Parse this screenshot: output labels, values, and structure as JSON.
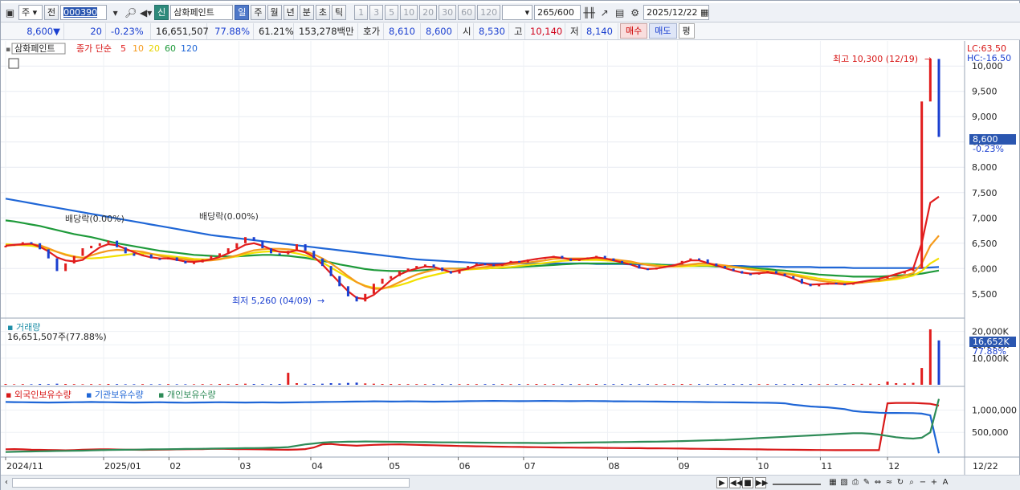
{
  "toolbar": {
    "market": "주",
    "prefix": "전",
    "code": "000390",
    "new_badge": "신",
    "stock_name": "삼화페인트",
    "periods": [
      "일",
      "주",
      "월",
      "년",
      "분",
      "초",
      "틱"
    ],
    "active_period": "일",
    "intervals": [
      "1",
      "3",
      "5",
      "10",
      "20",
      "30",
      "60",
      "120"
    ],
    "count": "265",
    "count_total": "/600",
    "date": "2025/12/22"
  },
  "quote": {
    "price": "8,600",
    "arrow": "▼",
    "change": "20",
    "change_pct": "-0.23%",
    "volume": "16,651,507",
    "vol_pct": "77.88%",
    "turnover": "61.21%",
    "amount": "153,278백만",
    "bid_label": "호가",
    "bid1": "8,610",
    "bid2": "8,600",
    "open_label": "시",
    "open": "8,530",
    "high_label": "고",
    "high": "10,140",
    "low_label": "저",
    "low": "8,140",
    "buy_label": "매수",
    "sell_label": "매도",
    "avg_label": "평"
  },
  "legend": {
    "name": "삼화페인트",
    "ma_label": "종가 단순",
    "ma_periods": [
      "5",
      "10",
      "20",
      "60",
      "120"
    ],
    "ma_colors": [
      "#e11d1d",
      "#f59a1c",
      "#f2e000",
      "#1e9a3a",
      "#1f66d6"
    ],
    "lc_label": "LC:63.50",
    "hc_label": "HC:-16.50"
  },
  "annotations": {
    "high": "최고 10,300 (12/19)",
    "low": "최저 5,260 (04/09)",
    "div1": "배당락(0.00%)",
    "div2": "배당락(0.00%)"
  },
  "axes": {
    "price_ticks": [
      "10,000",
      "9,500",
      "9,000",
      "8,500",
      "8,000",
      "7,500",
      "7,000",
      "6,500",
      "6,000",
      "5,500"
    ],
    "current_price": "8,600",
    "current_pct": "-0.23%",
    "volume_ticks": [
      "20,000K",
      "15,000K",
      "10,000K"
    ],
    "current_volume": "16,652K",
    "volume_pct": "77.88%",
    "holding_ticks": [
      "1,000,000",
      "500,000"
    ],
    "months": [
      "2024/11",
      "2025/01",
      "02",
      "03",
      "04",
      "05",
      "06",
      "07",
      "08",
      "09",
      "10",
      "11",
      "12"
    ],
    "last_date": "12/22"
  },
  "volume_panel": {
    "title": "거래량",
    "info": "16,651,507주(77.88%)"
  },
  "holding_panel": {
    "series": [
      "외국인보유수량",
      "기관보유수량",
      "개인보유수량"
    ],
    "colors": [
      "#d81818",
      "#1f66d6",
      "#2e8b57"
    ]
  },
  "chart_data": {
    "type": "line",
    "price_range": [
      5100,
      10400
    ],
    "close_series": [
      6450,
      6480,
      6520,
      6500,
      6380,
      6200,
      5950,
      6100,
      6250,
      6400,
      6450,
      6500,
      6550,
      6420,
      6300,
      6250,
      6280,
      6200,
      6180,
      6220,
      6150,
      6100,
      6120,
      6180,
      6250,
      6300,
      6400,
      6500,
      6620,
      6550,
      6400,
      6300,
      6280,
      6350,
      6480,
      6350,
      6200,
      6050,
      5850,
      5650,
      5450,
      5350,
      5500,
      5700,
      5800,
      5850,
      5950,
      6000,
      6050,
      6080,
      6020,
      5950,
      5900,
      5980,
      6050,
      6100,
      6080,
      6050,
      6100,
      6150,
      6120,
      6180,
      6200,
      6220,
      6250,
      6200,
      6150,
      6180,
      6220,
      6250,
      6200,
      6150,
      6100,
      6080,
      6000,
      5980,
      6020,
      6050,
      6080,
      6150,
      6200,
      6180,
      6100,
      6050,
      6000,
      5950,
      5900,
      5880,
      5920,
      5950,
      5900,
      5850,
      5800,
      5700,
      5650,
      5680,
      5720,
      5700,
      5680,
      5720,
      5750,
      5780,
      5800,
      5850,
      5900,
      5950,
      6000,
      9300,
      10140,
      8600
    ],
    "ma5": [
      6450,
      6470,
      6480,
      6490,
      6430,
      6340,
      6220,
      6160,
      6140,
      6170,
      6300,
      6420,
      6480,
      6460,
      6390,
      6320,
      6260,
      6220,
      6200,
      6200,
      6170,
      6140,
      6130,
      6150,
      6180,
      6230,
      6300,
      6380,
      6470,
      6500,
      6450,
      6380,
      6330,
      6320,
      6360,
      6320,
      6230,
      6080,
      5900,
      5720,
      5550,
      5420,
      5400,
      5480,
      5620,
      5770,
      5880,
      5950,
      6000,
      6040,
      6030,
      5980,
      5930,
      5960,
      6000,
      6060,
      6080,
      6070,
      6080,
      6120,
      6130,
      6160,
      6190,
      6210,
      6230,
      6210,
      6180,
      6180,
      6200,
      6220,
      6200,
      6160,
      6120,
      6080,
      6020,
      5990,
      6000,
      6030,
      6060,
      6110,
      6160,
      6160,
      6110,
      6060,
      6010,
      5960,
      5920,
      5900,
      5910,
      5920,
      5900,
      5860,
      5800,
      5730,
      5680,
      5690,
      5700,
      5700,
      5690,
      5710,
      5740,
      5770,
      5800,
      5840,
      5890,
      5940,
      6000,
      6500,
      7300,
      7420
    ],
    "ma10": [
      6450,
      6460,
      6470,
      6480,
      6460,
      6400,
      6330,
      6270,
      6230,
      6210,
      6260,
      6310,
      6350,
      6370,
      6360,
      6350,
      6330,
      6290,
      6250,
      6220,
      6200,
      6180,
      6160,
      6150,
      6160,
      6180,
      6220,
      6260,
      6310,
      6360,
      6380,
      6390,
      6390,
      6380,
      6360,
      6340,
      6280,
      6200,
      6100,
      5980,
      5850,
      5730,
      5650,
      5600,
      5600,
      5650,
      5730,
      5810,
      5880,
      5930,
      5970,
      6000,
      6000,
      5990,
      5990,
      6010,
      6030,
      6050,
      6060,
      6080,
      6100,
      6120,
      6140,
      6160,
      6190,
      6200,
      6200,
      6200,
      6200,
      6200,
      6190,
      6180,
      6160,
      6140,
      6100,
      6070,
      6050,
      6040,
      6040,
      6060,
      6080,
      6100,
      6100,
      6080,
      6060,
      6040,
      6010,
      5980,
      5960,
      5940,
      5920,
      5900,
      5870,
      5830,
      5790,
      5760,
      5740,
      5720,
      5710,
      5710,
      5720,
      5740,
      5760,
      5790,
      5820,
      5860,
      5910,
      6100,
      6450,
      6650
    ],
    "ma20": [
      6480,
      6470,
      6460,
      6450,
      6420,
      6380,
      6330,
      6280,
      6240,
      6210,
      6200,
      6210,
      6230,
      6250,
      6270,
      6290,
      6300,
      6290,
      6270,
      6250,
      6230,
      6210,
      6190,
      6180,
      6180,
      6190,
      6210,
      6240,
      6280,
      6310,
      6330,
      6340,
      6340,
      6330,
      6300,
      6260,
      6200,
      6120,
      6020,
      5920,
      5820,
      5730,
      5660,
      5620,
      5610,
      5630,
      5670,
      5720,
      5780,
      5830,
      5870,
      5910,
      5940,
      5960,
      5980,
      5990,
      6000,
      6010,
      6020,
      6030,
      6050,
      6070,
      6090,
      6110,
      6130,
      6150,
      6160,
      6170,
      6170,
      6170,
      6160,
      6150,
      6140,
      6120,
      6100,
      6080,
      6060,
      6050,
      6040,
      6040,
      6050,
      6060,
      6060,
      6060,
      6050,
      6030,
      6010,
      5990,
      5970,
      5950,
      5930,
      5910,
      5890,
      5860,
      5830,
      5800,
      5780,
      5760,
      5740,
      5730,
      5730,
      5740,
      5750,
      5770,
      5790,
      5820,
      5860,
      5950,
      6100,
      6200
    ],
    "ma60": [
      6950,
      6930,
      6900,
      6870,
      6840,
      6800,
      6760,
      6720,
      6680,
      6650,
      6620,
      6580,
      6540,
      6500,
      6470,
      6440,
      6410,
      6380,
      6350,
      6330,
      6310,
      6290,
      6270,
      6260,
      6250,
      6240,
      6240,
      6240,
      6250,
      6260,
      6270,
      6270,
      6260,
      6250,
      6230,
      6210,
      6180,
      6150,
      6120,
      6080,
      6050,
      6020,
      5990,
      5970,
      5960,
      5950,
      5950,
      5950,
      5960,
      5970,
      5980,
      5990,
      6000,
      6000,
      6000,
      6000,
      6000,
      6010,
      6010,
      6020,
      6030,
      6040,
      6050,
      6060,
      6070,
      6080,
      6090,
      6100,
      6100,
      6100,
      6100,
      6100,
      6100,
      6100,
      6100,
      6090,
      6080,
      6070,
      6060,
      6060,
      6050,
      6050,
      6050,
      6040,
      6040,
      6030,
      6020,
      6010,
      6000,
      5990,
      5970,
      5960,
      5940,
      5920,
      5900,
      5880,
      5870,
      5860,
      5850,
      5840,
      5840,
      5840,
      5840,
      5850,
      5860,
      5870,
      5880,
      5900,
      5930,
      5960
    ],
    "ma120": [
      7380,
      7350,
      7320,
      7290,
      7260,
      7230,
      7200,
      7170,
      7140,
      7110,
      7080,
      7050,
      7020,
      6990,
      6960,
      6930,
      6900,
      6870,
      6840,
      6810,
      6780,
      6750,
      6720,
      6690,
      6660,
      6640,
      6620,
      6600,
      6580,
      6560,
      6540,
      6520,
      6500,
      6480,
      6460,
      6440,
      6420,
      6400,
      6380,
      6360,
      6340,
      6320,
      6300,
      6280,
      6260,
      6240,
      6220,
      6200,
      6180,
      6170,
      6160,
      6150,
      6140,
      6130,
      6120,
      6110,
      6100,
      6100,
      6100,
      6100,
      6100,
      6100,
      6100,
      6100,
      6100,
      6100,
      6100,
      6100,
      6100,
      6090,
      6090,
      6090,
      6090,
      6080,
      6080,
      6080,
      6080,
      6070,
      6070,
      6070,
      6060,
      6060,
      6060,
      6060,
      6050,
      6050,
      6050,
      6040,
      6040,
      6040,
      6040,
      6030,
      6030,
      6030,
      6030,
      6020,
      6020,
      6020,
      6020,
      6010,
      6010,
      6010,
      6010,
      6010,
      6010,
      6010,
      6010,
      6010,
      6020,
      6030
    ],
    "volume_range": [
      0,
      22000
    ],
    "volume_k": [
      300,
      200,
      250,
      200,
      300,
      250,
      400,
      300,
      250,
      200,
      250,
      200,
      300,
      250,
      200,
      200,
      250,
      200,
      200,
      250,
      200,
      200,
      200,
      250,
      200,
      300,
      250,
      300,
      400,
      300,
      250,
      250,
      300,
      4500,
      600,
      400,
      300,
      400,
      600,
      500,
      700,
      800,
      500,
      400,
      300,
      300,
      250,
      250,
      250,
      250,
      250,
      250,
      250,
      250,
      250,
      250,
      250,
      250,
      250,
      250,
      250,
      250,
      300,
      250,
      250,
      250,
      250,
      250,
      250,
      300,
      250,
      250,
      250,
      250,
      250,
      250,
      250,
      250,
      250,
      300,
      250,
      250,
      250,
      250,
      250,
      250,
      250,
      250,
      250,
      250,
      250,
      250,
      250,
      300,
      250,
      250,
      250,
      250,
      250,
      300,
      350,
      400,
      300,
      1200,
      600,
      500,
      700,
      6300,
      20800,
      16652
    ],
    "holding_range": [
      0,
      1350000
    ],
    "foreign_holding": [
      120000,
      125000,
      118000,
      110000,
      108000,
      105000,
      100000,
      98000,
      102000,
      110000,
      115000,
      120000,
      118000,
      115000,
      112000,
      110000,
      108000,
      110000,
      112000,
      115000,
      118000,
      120000,
      122000,
      125000,
      130000,
      132000,
      128000,
      125000,
      122000,
      120000,
      118000,
      115000,
      112000,
      110000,
      115000,
      125000,
      160000,
      230000,
      240000,
      220000,
      210000,
      200000,
      210000,
      220000,
      225000,
      228000,
      230000,
      225000,
      220000,
      215000,
      210000,
      205000,
      200000,
      195000,
      190000,
      188000,
      185000,
      180000,
      178000,
      175000,
      172000,
      170000,
      168000,
      165000,
      162000,
      160000,
      158000,
      156000,
      155000,
      154000,
      152000,
      150000,
      148000,
      146000,
      145000,
      143000,
      142000,
      140000,
      138000,
      136000,
      134000,
      132000,
      130000,
      128000,
      126000,
      124000,
      122000,
      120000,
      118000,
      116000,
      114000,
      112000,
      110000,
      108000,
      106000,
      104000,
      102000,
      100000,
      100000,
      100000,
      100000,
      100000,
      100000,
      1150000,
      1160000,
      1160000,
      1160000,
      1150000,
      1140000,
      1100000
    ],
    "institution_holding": [
      1180000,
      1178000,
      1175000,
      1172000,
      1170000,
      1168000,
      1170000,
      1172000,
      1175000,
      1178000,
      1180000,
      1178000,
      1175000,
      1172000,
      1170000,
      1168000,
      1170000,
      1172000,
      1175000,
      1170000,
      1168000,
      1165000,
      1168000,
      1170000,
      1172000,
      1175000,
      1172000,
      1170000,
      1168000,
      1170000,
      1172000,
      1170000,
      1168000,
      1170000,
      1172000,
      1175000,
      1178000,
      1180000,
      1182000,
      1185000,
      1188000,
      1190000,
      1192000,
      1195000,
      1193000,
      1190000,
      1192000,
      1195000,
      1193000,
      1190000,
      1188000,
      1190000,
      1192000,
      1195000,
      1198000,
      1200000,
      1202000,
      1205000,
      1203000,
      1200000,
      1198000,
      1200000,
      1202000,
      1205000,
      1203000,
      1200000,
      1198000,
      1200000,
      1202000,
      1200000,
      1198000,
      1196000,
      1195000,
      1194000,
      1193000,
      1192000,
      1190000,
      1188000,
      1186000,
      1184000,
      1182000,
      1180000,
      1178000,
      1176000,
      1174000,
      1172000,
      1170000,
      1168000,
      1165000,
      1162000,
      1160000,
      1150000,
      1120000,
      1100000,
      1080000,
      1070000,
      1060000,
      1040000,
      1020000,
      980000,
      960000,
      950000,
      940000,
      935000,
      935000,
      932000,
      930000,
      920000,
      880000,
      30000
    ],
    "individual_holding": [
      60000,
      65000,
      70000,
      72000,
      75000,
      80000,
      82000,
      85000,
      88000,
      90000,
      95000,
      100000,
      105000,
      108000,
      110000,
      112000,
      115000,
      118000,
      120000,
      122000,
      125000,
      128000,
      130000,
      132000,
      135000,
      138000,
      140000,
      142000,
      145000,
      148000,
      150000,
      155000,
      160000,
      170000,
      200000,
      230000,
      250000,
      270000,
      280000,
      285000,
      290000,
      292000,
      295000,
      293000,
      290000,
      288000,
      286000,
      284000,
      282000,
      280000,
      278000,
      276000,
      275000,
      274000,
      272000,
      270000,
      268000,
      266000,
      265000,
      264000,
      263000,
      262000,
      261000,
      260000,
      262000,
      265000,
      268000,
      270000,
      272000,
      275000,
      278000,
      280000,
      282000,
      285000,
      288000,
      290000,
      292000,
      295000,
      300000,
      305000,
      310000,
      315000,
      320000,
      325000,
      330000,
      340000,
      350000,
      360000,
      370000,
      380000,
      390000,
      400000,
      410000,
      420000,
      430000,
      440000,
      450000,
      460000,
      470000,
      480000,
      480000,
      470000,
      450000,
      420000,
      390000,
      370000,
      360000,
      380000,
      500000,
      1250000
    ]
  }
}
